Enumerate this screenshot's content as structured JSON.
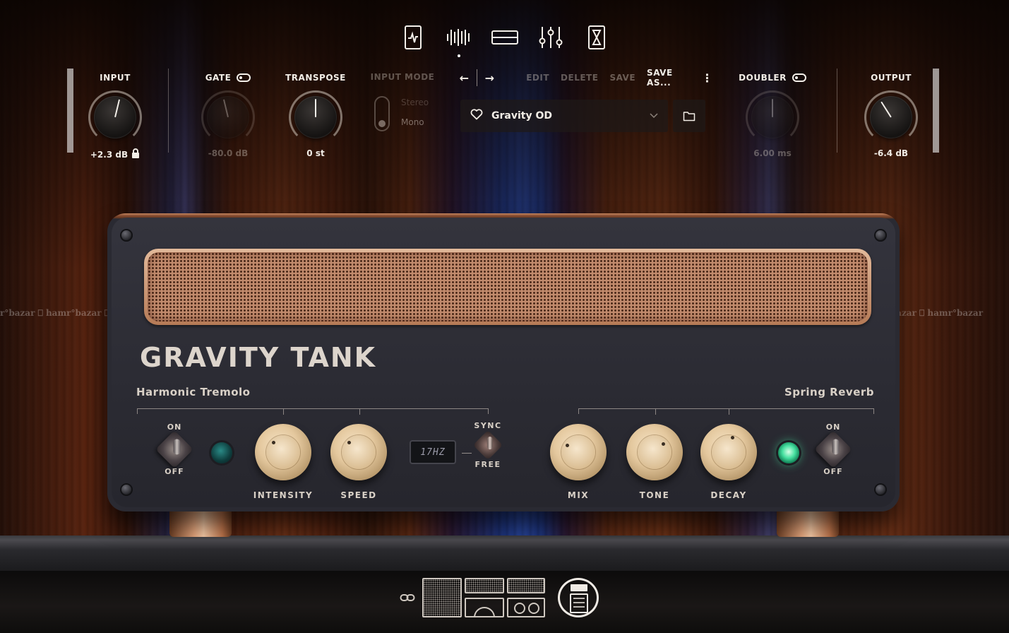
{
  "top_nav": {
    "items": [
      {
        "name": "tuner"
      },
      {
        "name": "waveform-view"
      },
      {
        "name": "amp-view"
      },
      {
        "name": "mixer-view"
      },
      {
        "name": "timer-view"
      }
    ],
    "active_index": 1
  },
  "input": {
    "label": "INPUT",
    "value": "+2.3 dB",
    "level": 0.55
  },
  "gate": {
    "label": "GATE",
    "value": "-80.0 dB",
    "enabled": false,
    "level": 0.45
  },
  "transpose": {
    "label": "TRANSPOSE",
    "value": "0 st",
    "level": 0.5
  },
  "input_mode": {
    "label": "INPUT MODE",
    "options": [
      "Stereo",
      "Mono"
    ],
    "selected": "Mono"
  },
  "preset_toolbar": {
    "back": "←",
    "forward": "→",
    "edit": "EDIT",
    "delete": "DELETE",
    "save": "SAVE",
    "save_as": "SAVE AS...",
    "more": "⋮"
  },
  "preset": {
    "name": "Gravity OD",
    "favorite_icon": "heart-icon"
  },
  "doubler": {
    "label": "DOUBLER",
    "value": "6.00 ms",
    "enabled": false,
    "level": 0.5
  },
  "output": {
    "label": "OUTPUT",
    "value": "-6.4 dB",
    "level": 0.38
  },
  "amp": {
    "title": "GRAVITY TANK",
    "tremolo": {
      "title": "Harmonic Tremolo",
      "on_label": "ON",
      "off_label": "OFF",
      "intensity_label": "INTENSITY",
      "speed_label": "SPEED",
      "rate_display": "17HZ",
      "sync_label": "SYNC",
      "free_label": "FREE"
    },
    "reverb": {
      "title": "Spring Reverb",
      "mix_label": "MIX",
      "tone_label": "TONE",
      "decay_label": "DECAY",
      "on_label": "ON",
      "off_label": "OFF"
    }
  },
  "watermark": {
    "left": "r°bazar  ⎕ hamr°bazar  ⎕ h",
    "right": "amr°bazar  ⎕ hamr°bazar"
  },
  "bottom_selector": {
    "items": [
      "cab-1x12",
      "cab-2x12",
      "cab-4x10",
      "head"
    ],
    "active": "head"
  },
  "colors": {
    "accent": "#f2ede6",
    "led_on": "#46e0a0",
    "knob_cream": "#e4c89e",
    "grille": "#c18a6c"
  }
}
